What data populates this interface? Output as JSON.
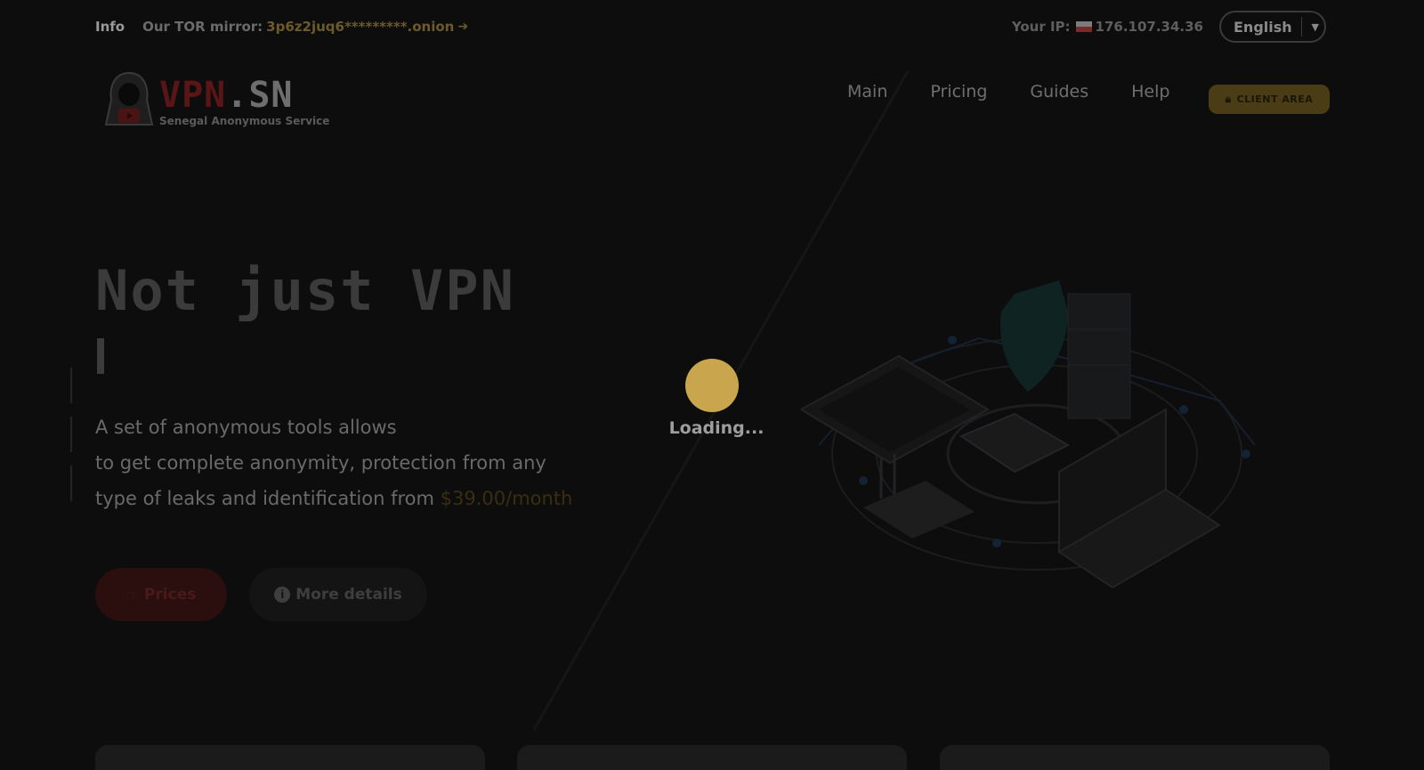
{
  "infobar": {
    "info_label": "Info",
    "mirror_label": "Our TOR mirror:",
    "mirror_value": "3p6z2juq6*********.onion",
    "ip_label": "Your IP:",
    "ip_value": "176.107.34.36",
    "language": "English"
  },
  "header": {
    "brand_part1": "VPN",
    "brand_part2": ".SN",
    "brand_subtitle": "Senegal Anonymous Service",
    "nav": [
      "Main",
      "Pricing",
      "Guides",
      "Help"
    ],
    "client_area": "CLIENT AREA"
  },
  "hero": {
    "title": "Not just VPN",
    "desc_line1": "A set of anonymous tools allows",
    "desc_line2": "to get complete anonymity, protection from any",
    "desc_line3": "type of leaks and identification from",
    "price": "$39.00/month",
    "btn_prices": "Prices",
    "btn_details": "More details"
  },
  "loader": {
    "text": "Loading..."
  },
  "colors": {
    "accent": "#c9a64e",
    "brand_red": "#5a1616"
  }
}
